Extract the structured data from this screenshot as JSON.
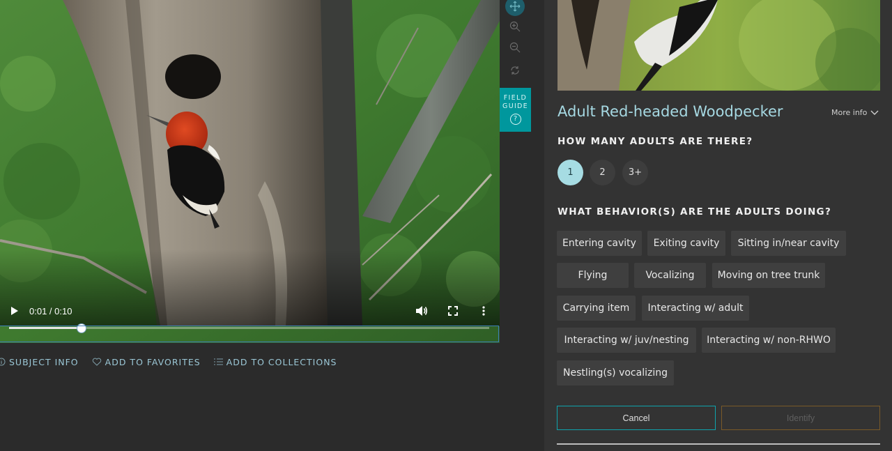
{
  "video": {
    "time_display": "0:01 / 0:10",
    "progress": 0.15
  },
  "toolbar": {
    "field_guide_line1": "FIELD",
    "field_guide_line2": "GUIDE",
    "field_guide_q": "?"
  },
  "subject_actions": {
    "subject_info": "SUBJECT INFO",
    "add_to_favorites": "ADD TO FAVORITES",
    "add_to_collections": "ADD TO COLLECTIONS"
  },
  "identify_panel": {
    "species": "Adult Red-headed Woodpecker",
    "more_info": "More info",
    "question_count": "HOW MANY ADULTS ARE THERE?",
    "count_options": [
      "1",
      "2",
      "3+"
    ],
    "count_selected": "1",
    "question_behavior": "WHAT BEHAVIOR(S) ARE THE ADULTS DOING?",
    "behaviors": [
      "Entering cavity",
      "Exiting cavity",
      "Sitting in/near cavity",
      "Flying",
      "Vocalizing",
      "Moving on tree trunk",
      "Carrying item",
      "Interacting w/ adult",
      "Interacting w/ juv/nesting",
      "Interacting w/ non-RHWO",
      "Nestling(s) vocalizing"
    ],
    "cancel_label": "Cancel",
    "identify_label": "Identify"
  },
  "colors": {
    "accent_teal": "#00979d",
    "selected_fill": "#a6dce3",
    "title": "#a6d9e3",
    "identify_border": "#7a5a28"
  }
}
